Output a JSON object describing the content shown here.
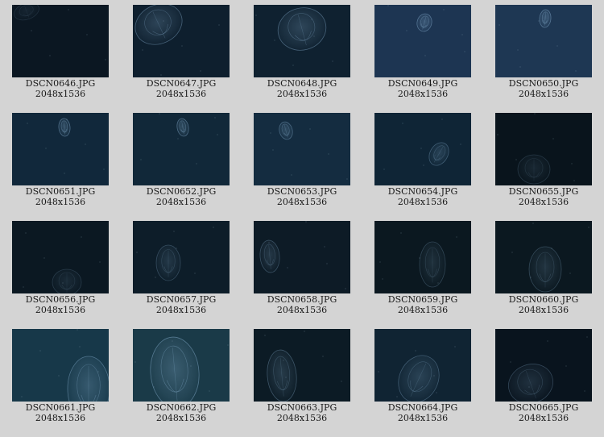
{
  "gallery": {
    "items": [
      {
        "filename": "DSCN0646.JPG",
        "dimensions": "2048x1536",
        "bg": "#0b1722"
      },
      {
        "filename": "DSCN0647.JPG",
        "dimensions": "2048x1536",
        "bg": "#0e1f2e"
      },
      {
        "filename": "DSCN0648.JPG",
        "dimensions": "2048x1536",
        "bg": "#0f2130"
      },
      {
        "filename": "DSCN0649.JPG",
        "dimensions": "2048x1536",
        "bg": "#1d3552"
      },
      {
        "filename": "DSCN0650.JPG",
        "dimensions": "2048x1536",
        "bg": "#1e3753"
      },
      {
        "filename": "DSCN0651.JPG",
        "dimensions": "2048x1536",
        "bg": "#11283b"
      },
      {
        "filename": "DSCN0652.JPG",
        "dimensions": "2048x1536",
        "bg": "#112839"
      },
      {
        "filename": "DSCN0653.JPG",
        "dimensions": "2048x1536",
        "bg": "#142c40"
      },
      {
        "filename": "DSCN0654.JPG",
        "dimensions": "2048x1536",
        "bg": "#0f2536"
      },
      {
        "filename": "DSCN0655.JPG",
        "dimensions": "2048x1536",
        "bg": "#09141c"
      },
      {
        "filename": "DSCN0656.JPG",
        "dimensions": "2048x1536",
        "bg": "#0b1822"
      },
      {
        "filename": "DSCN0657.JPG",
        "dimensions": "2048x1536",
        "bg": "#0d1d29"
      },
      {
        "filename": "DSCN0658.JPG",
        "dimensions": "2048x1536",
        "bg": "#0d1b26"
      },
      {
        "filename": "DSCN0659.JPG",
        "dimensions": "2048x1536",
        "bg": "#0b1820"
      },
      {
        "filename": "DSCN0660.JPG",
        "dimensions": "2048x1536",
        "bg": "#0b1820"
      },
      {
        "filename": "DSCN0661.JPG",
        "dimensions": "2048x1536",
        "bg": "#173849"
      },
      {
        "filename": "DSCN0662.JPG",
        "dimensions": "2048x1536",
        "bg": "#1a3a48"
      },
      {
        "filename": "DSCN0663.JPG",
        "dimensions": "2048x1536",
        "bg": "#0c1b25"
      },
      {
        "filename": "DSCN0664.JPG",
        "dimensions": "2048x1536",
        "bg": "#102433"
      },
      {
        "filename": "DSCN0665.JPG",
        "dimensions": "2048x1536",
        "bg": "#09141e"
      }
    ]
  },
  "colors": {
    "page_background": "#d4d4d4",
    "label_text": "#1a1a1a",
    "jelly_glow": "#8fb8d8"
  }
}
